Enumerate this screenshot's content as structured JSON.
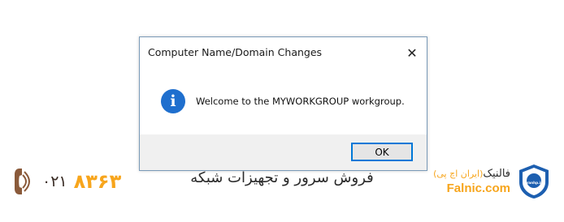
{
  "dialog": {
    "title": "Computer Name/Domain Changes",
    "close_glyph": "✕",
    "message": "Welcome to the MYWORKGROUP workgroup.",
    "icon": "info-icon",
    "icon_glyph": "i",
    "ok_label": "OK"
  },
  "branding": {
    "phone_prefix": "۰۲۱",
    "phone_number": "۸۳۶۳",
    "caption": "فروش سرور و تجهیزات شبکه",
    "brand_name_fa": "فالنیک",
    "brand_sub_fa": "(ایران اچ پی)",
    "brand_name_en": "Falnic.com",
    "logo_text": "iranhp.ir"
  },
  "colors": {
    "accent_orange": "#f7a51c",
    "info_blue": "#1f6fce",
    "focus_border": "#0078d7"
  }
}
